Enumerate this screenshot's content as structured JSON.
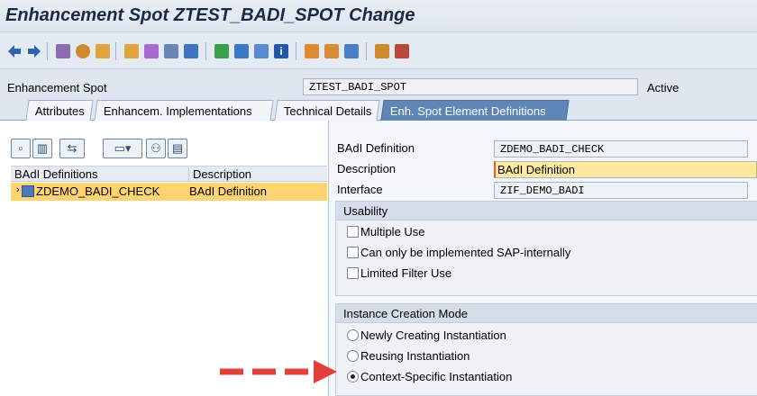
{
  "window": {
    "title": "Enhancement Spot ZTEST_BADI_SPOT Change"
  },
  "toolbar": {
    "icons": [
      "back-icon",
      "forward-icon",
      "display-change-icon",
      "other-object-icon",
      "active-inactive-icon",
      "where-used-icon",
      "magic-wand-icon",
      "object-list-icon",
      "navigate-icon",
      "hierarchy-icon",
      "stack-icon",
      "table-icon",
      "info-icon",
      "cut-icon",
      "copy-icon",
      "paste-icon",
      "undo-icon",
      "find-icon"
    ]
  },
  "header": {
    "label": "Enhancement Spot",
    "value": "ZTEST_BADI_SPOT",
    "status": "Active"
  },
  "tabs": [
    {
      "label": "Attributes"
    },
    {
      "label": "Enhancem. Implementations"
    },
    {
      "label": "Technical Details"
    },
    {
      "label": "Enh. Spot Element Definitions",
      "active": true
    }
  ],
  "left": {
    "buttons": [
      "create-icon",
      "delete-icon",
      "move-icon",
      "expand-icon",
      "find-icon",
      "details-icon"
    ],
    "columns": [
      "BAdI Definitions",
      "Description"
    ],
    "rows": [
      {
        "name": "ZDEMO_BADI_CHECK",
        "description": "BAdI  Definition"
      }
    ]
  },
  "detail": {
    "badi_label": "BAdI Definition",
    "badi_value": "ZDEMO_BADI_CHECK",
    "desc_label": "Description",
    "desc_value": "BAdI  Definition",
    "intf_label": "Interface",
    "intf_value": "ZIF_DEMO_BADI"
  },
  "usability": {
    "title": "Usability",
    "options": [
      {
        "label": "Multiple Use",
        "checked": false
      },
      {
        "label": "Can only be implemented SAP-internally",
        "checked": false
      },
      {
        "label": "Limited Filter Use",
        "checked": false
      }
    ]
  },
  "instance_mode": {
    "title": "Instance Creation Mode",
    "options": [
      {
        "label": "Newly Creating Instantiation",
        "selected": false
      },
      {
        "label": "Reusing Instantiation",
        "selected": false
      },
      {
        "label": "Context-Specific Instantiation",
        "selected": true
      }
    ]
  },
  "colors": {
    "accent": "#5e86b6",
    "highlight": "#ffd470",
    "arrow": "#e0403a"
  }
}
